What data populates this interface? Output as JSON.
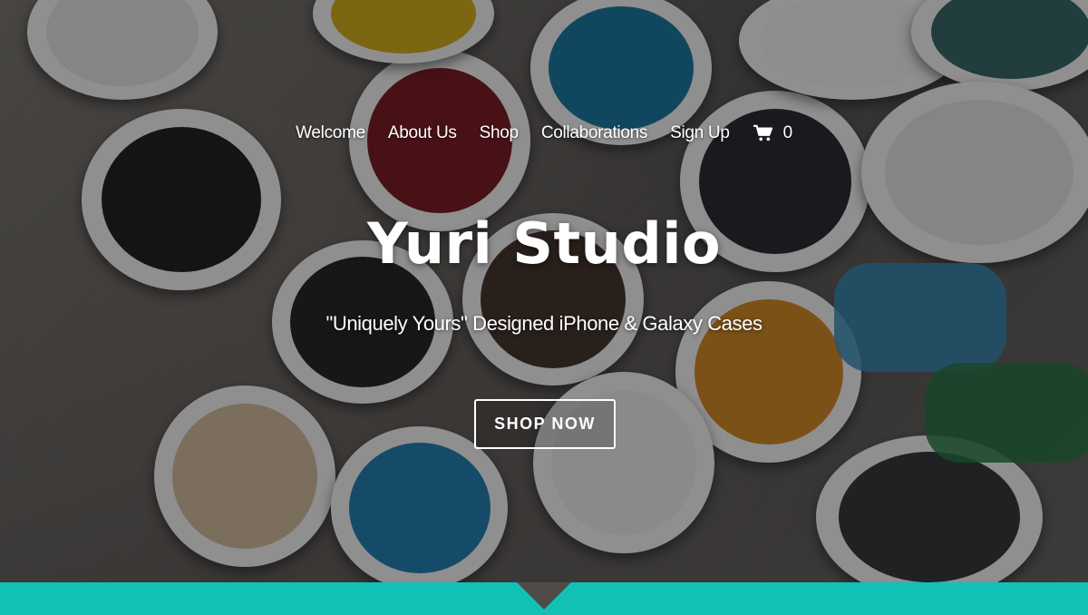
{
  "nav": {
    "items": [
      {
        "label": "Welcome"
      },
      {
        "label": "About Us"
      },
      {
        "label": "Shop"
      },
      {
        "label": "Collaborations"
      },
      {
        "label": "Sign Up"
      }
    ],
    "cart_count": "0",
    "cart_icon": "shopping-cart-icon"
  },
  "hero": {
    "title": "Yuri Studio",
    "subtitle": "\"Uniquely Yours\" Designed iPhone & Galaxy Cases",
    "cta_label": "SHOP NOW",
    "background": "paint-buckets-photo"
  },
  "colors": {
    "accent": "#12c1b6",
    "text": "#ffffff"
  }
}
